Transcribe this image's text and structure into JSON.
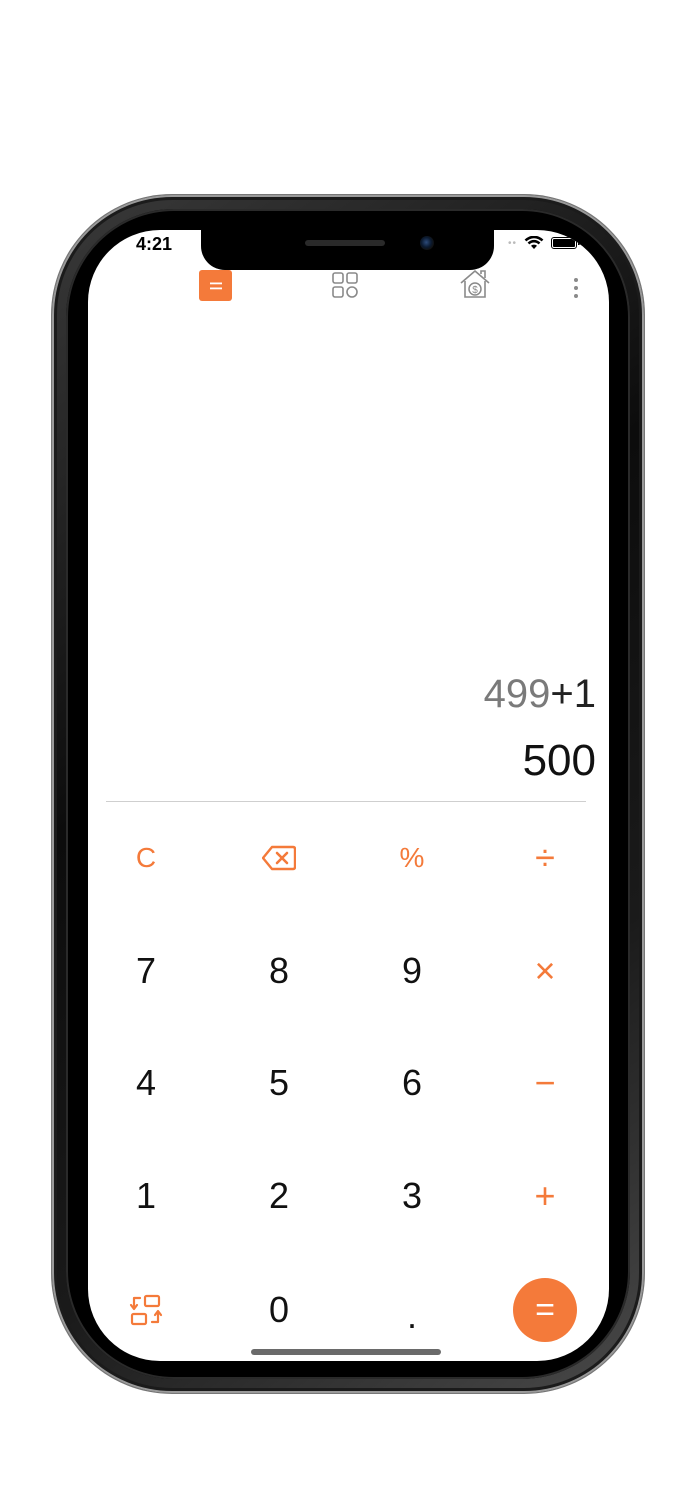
{
  "status_bar": {
    "time": "4:21",
    "signal": "••"
  },
  "topbar": {
    "tabs": [
      {
        "name": "calculator",
        "icon": "equals-icon",
        "active": true
      },
      {
        "name": "apps",
        "icon": "grid-icon",
        "active": false
      },
      {
        "name": "finance",
        "icon": "house-dollar-icon",
        "active": false
      }
    ],
    "menu_icon": "more-vertical-icon"
  },
  "display": {
    "expression_left": "499",
    "expression_op": "+",
    "expression_right": "1",
    "result": "500"
  },
  "keypad": {
    "row1": [
      "C",
      "⌫",
      "%",
      "÷"
    ],
    "row2": [
      "7",
      "8",
      "9",
      "×"
    ],
    "row3": [
      "4",
      "5",
      "6",
      "−"
    ],
    "row4": [
      "1",
      "2",
      "3",
      "+"
    ],
    "row5": [
      "",
      "0",
      ".",
      "="
    ]
  },
  "colors": {
    "accent": "#f47a3a",
    "text": "#111111",
    "expression": "#7a7a7a"
  }
}
